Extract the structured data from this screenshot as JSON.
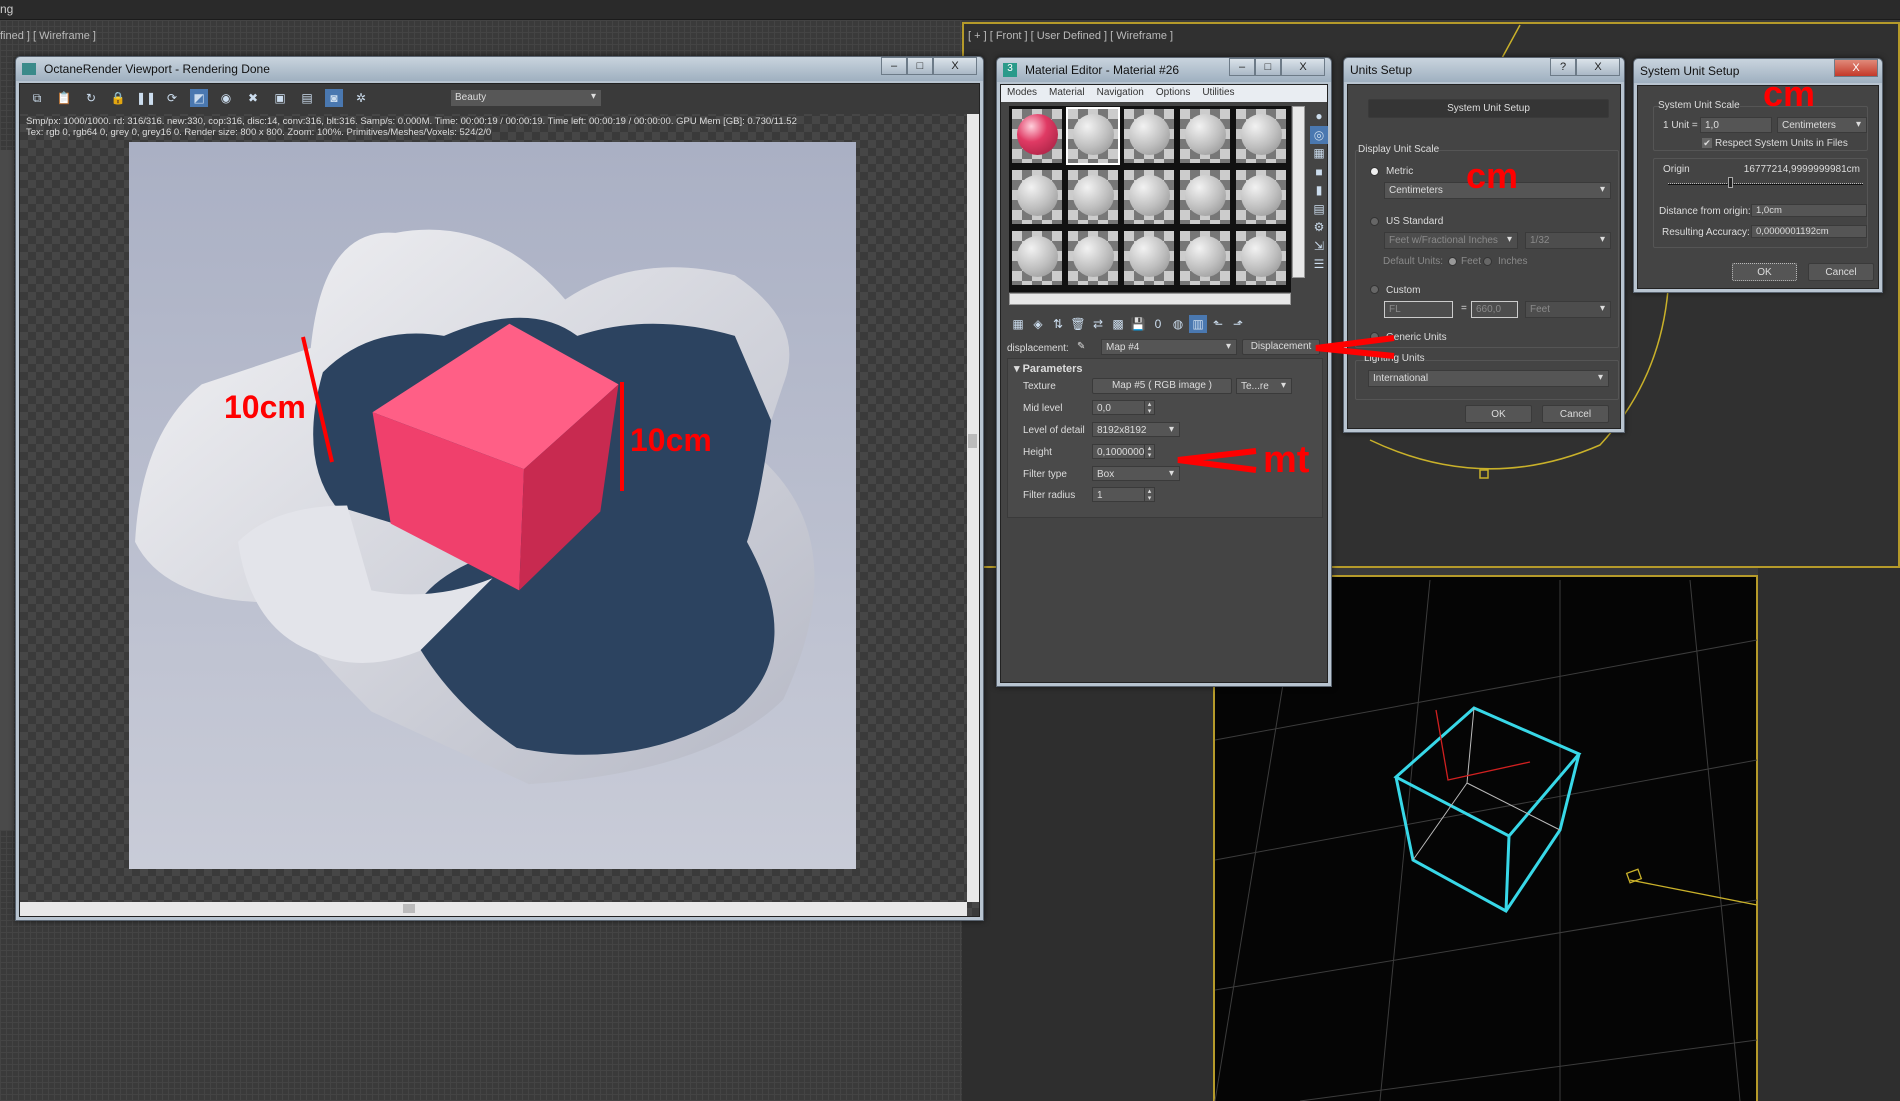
{
  "app_menu_fragment": "ng",
  "left_viewport_label": "fined ] [ Wireframe ]",
  "top_viewport_label": "[ + ] [ Front ] [ User Defined ] [ Wireframe ]",
  "octane": {
    "title": "OctaneRender Viewport - Rendering Done",
    "pass_select": "Beauty",
    "stats_line1": "Smp/px: 1000/1000.   rd: 316/316.   new:330, cop:316, disc:14, conv:316, blt:316.   Samp/s: 0.000M.   Time: 00:00:19 / 00:00:19.   Time left: 00:00:19 / 00:00:00.   GPU Mem [GB]: 0.730/11.52",
    "stats_line2": "Tex: rgb 0, rgb64 0, grey 0, grey16 0.   Render size: 800 x 800.   Zoom: 100%.   Primitives/Meshes/Voxels: 524/2/0",
    "toolbar_icons": [
      "copy-icon",
      "clipboard-icon",
      "refresh-icon",
      "lock-icon",
      "pause-icon",
      "restart-icon",
      "region-icon",
      "color-icon",
      "stop-icon",
      "display-icon",
      "save-icon",
      "camera-icon",
      "settings-icon"
    ]
  },
  "annotations": {
    "left_height": "10cm",
    "right_height": "10cm",
    "height_unit": "mt",
    "display_unit": "cm",
    "system_unit": "cm"
  },
  "material_editor": {
    "title": "Material Editor - Material #26",
    "menu": [
      "Modes",
      "Material",
      "Navigation",
      "Options",
      "Utilities"
    ],
    "sample_slots": [
      "#e03a64",
      "#bfbfbf",
      "#bfbfbf",
      "#bfbfbf",
      "#bfbfbf",
      "#bfbfbf",
      "#bfbfbf",
      "#bfbfbf",
      "#bfbfbf",
      "#bfbfbf",
      "#bfbfbf",
      "#bfbfbf",
      "#bfbfbf",
      "#bfbfbf",
      "#bfbfbf"
    ],
    "map_label": "displacement:",
    "map_select": "Map #4",
    "map_type_button": "Displacement",
    "rollout_title": "Parameters",
    "params": {
      "texture_label": "Texture",
      "texture_value": "Map #5  ( RGB image )",
      "texture_mode": "Te...re",
      "mid_level_label": "Mid level",
      "mid_level_value": "0,0",
      "lod_label": "Level of detail",
      "lod_value": "8192x8192",
      "height_label": "Height",
      "height_value": "0,1000000",
      "filter_type_label": "Filter type",
      "filter_type_value": "Box",
      "filter_radius_label": "Filter radius",
      "filter_radius_value": "1"
    }
  },
  "units_setup": {
    "title": "Units Setup",
    "system_unit_button": "System Unit Setup",
    "display_group": "Display Unit Scale",
    "metric_label": "Metric",
    "metric_value": "Centimeters",
    "us_label": "US Standard",
    "us_value": "Feet w/Fractional Inches",
    "us_fraction": "1/32",
    "default_units_label": "Default Units:",
    "feet_label": "Feet",
    "inches_label": "Inches",
    "custom_label": "Custom",
    "custom_name": "FL",
    "custom_equals": "=",
    "custom_value": "660,0",
    "custom_unit": "Feet",
    "generic_label": "Generic Units",
    "lighting_group": "Lighting Units",
    "lighting_value": "International",
    "ok": "OK",
    "cancel": "Cancel",
    "help": "?",
    "close": "X"
  },
  "system_unit_setup": {
    "title": "System Unit Setup",
    "scale_group": "System Unit Scale",
    "unit_label": "1 Unit =",
    "unit_value": "1,0",
    "unit_type": "Centimeters",
    "respect_label": "Respect System Units in Files",
    "respect_checked": true,
    "origin_label": "Origin",
    "origin_value": "16777214,9999999981cm",
    "distance_label": "Distance from origin:",
    "distance_value": "1,0cm",
    "accuracy_label": "Resulting Accuracy:",
    "accuracy_value": "0,0000001192cm",
    "ok": "OK",
    "cancel": "Cancel",
    "close": "X"
  }
}
